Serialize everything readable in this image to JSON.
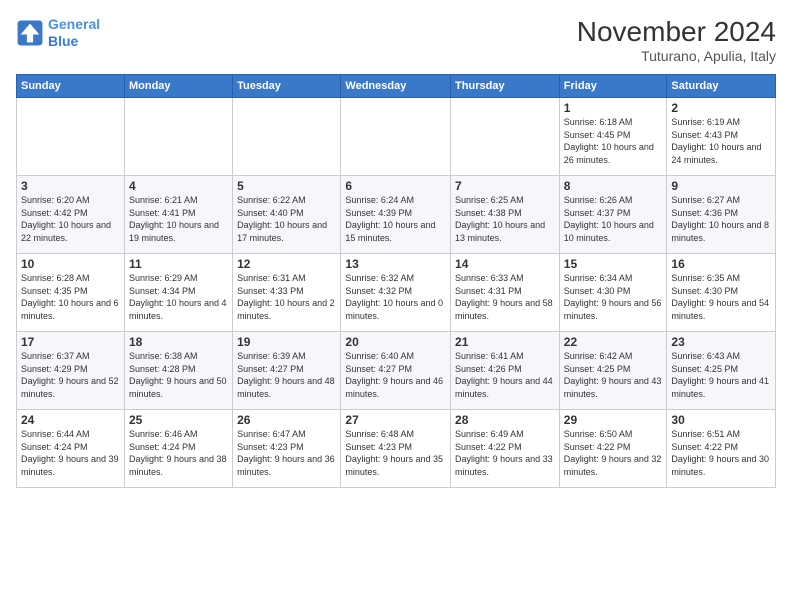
{
  "logo": {
    "line1": "General",
    "line2": "Blue"
  },
  "title": "November 2024",
  "subtitle": "Tuturano, Apulia, Italy",
  "weekdays": [
    "Sunday",
    "Monday",
    "Tuesday",
    "Wednesday",
    "Thursday",
    "Friday",
    "Saturday"
  ],
  "weeks": [
    [
      {
        "day": "",
        "info": ""
      },
      {
        "day": "",
        "info": ""
      },
      {
        "day": "",
        "info": ""
      },
      {
        "day": "",
        "info": ""
      },
      {
        "day": "",
        "info": ""
      },
      {
        "day": "1",
        "info": "Sunrise: 6:18 AM\nSunset: 4:45 PM\nDaylight: 10 hours and 26 minutes."
      },
      {
        "day": "2",
        "info": "Sunrise: 6:19 AM\nSunset: 4:43 PM\nDaylight: 10 hours and 24 minutes."
      }
    ],
    [
      {
        "day": "3",
        "info": "Sunrise: 6:20 AM\nSunset: 4:42 PM\nDaylight: 10 hours and 22 minutes."
      },
      {
        "day": "4",
        "info": "Sunrise: 6:21 AM\nSunset: 4:41 PM\nDaylight: 10 hours and 19 minutes."
      },
      {
        "day": "5",
        "info": "Sunrise: 6:22 AM\nSunset: 4:40 PM\nDaylight: 10 hours and 17 minutes."
      },
      {
        "day": "6",
        "info": "Sunrise: 6:24 AM\nSunset: 4:39 PM\nDaylight: 10 hours and 15 minutes."
      },
      {
        "day": "7",
        "info": "Sunrise: 6:25 AM\nSunset: 4:38 PM\nDaylight: 10 hours and 13 minutes."
      },
      {
        "day": "8",
        "info": "Sunrise: 6:26 AM\nSunset: 4:37 PM\nDaylight: 10 hours and 10 minutes."
      },
      {
        "day": "9",
        "info": "Sunrise: 6:27 AM\nSunset: 4:36 PM\nDaylight: 10 hours and 8 minutes."
      }
    ],
    [
      {
        "day": "10",
        "info": "Sunrise: 6:28 AM\nSunset: 4:35 PM\nDaylight: 10 hours and 6 minutes."
      },
      {
        "day": "11",
        "info": "Sunrise: 6:29 AM\nSunset: 4:34 PM\nDaylight: 10 hours and 4 minutes."
      },
      {
        "day": "12",
        "info": "Sunrise: 6:31 AM\nSunset: 4:33 PM\nDaylight: 10 hours and 2 minutes."
      },
      {
        "day": "13",
        "info": "Sunrise: 6:32 AM\nSunset: 4:32 PM\nDaylight: 10 hours and 0 minutes."
      },
      {
        "day": "14",
        "info": "Sunrise: 6:33 AM\nSunset: 4:31 PM\nDaylight: 9 hours and 58 minutes."
      },
      {
        "day": "15",
        "info": "Sunrise: 6:34 AM\nSunset: 4:30 PM\nDaylight: 9 hours and 56 minutes."
      },
      {
        "day": "16",
        "info": "Sunrise: 6:35 AM\nSunset: 4:30 PM\nDaylight: 9 hours and 54 minutes."
      }
    ],
    [
      {
        "day": "17",
        "info": "Sunrise: 6:37 AM\nSunset: 4:29 PM\nDaylight: 9 hours and 52 minutes."
      },
      {
        "day": "18",
        "info": "Sunrise: 6:38 AM\nSunset: 4:28 PM\nDaylight: 9 hours and 50 minutes."
      },
      {
        "day": "19",
        "info": "Sunrise: 6:39 AM\nSunset: 4:27 PM\nDaylight: 9 hours and 48 minutes."
      },
      {
        "day": "20",
        "info": "Sunrise: 6:40 AM\nSunset: 4:27 PM\nDaylight: 9 hours and 46 minutes."
      },
      {
        "day": "21",
        "info": "Sunrise: 6:41 AM\nSunset: 4:26 PM\nDaylight: 9 hours and 44 minutes."
      },
      {
        "day": "22",
        "info": "Sunrise: 6:42 AM\nSunset: 4:25 PM\nDaylight: 9 hours and 43 minutes."
      },
      {
        "day": "23",
        "info": "Sunrise: 6:43 AM\nSunset: 4:25 PM\nDaylight: 9 hours and 41 minutes."
      }
    ],
    [
      {
        "day": "24",
        "info": "Sunrise: 6:44 AM\nSunset: 4:24 PM\nDaylight: 9 hours and 39 minutes."
      },
      {
        "day": "25",
        "info": "Sunrise: 6:46 AM\nSunset: 4:24 PM\nDaylight: 9 hours and 38 minutes."
      },
      {
        "day": "26",
        "info": "Sunrise: 6:47 AM\nSunset: 4:23 PM\nDaylight: 9 hours and 36 minutes."
      },
      {
        "day": "27",
        "info": "Sunrise: 6:48 AM\nSunset: 4:23 PM\nDaylight: 9 hours and 35 minutes."
      },
      {
        "day": "28",
        "info": "Sunrise: 6:49 AM\nSunset: 4:22 PM\nDaylight: 9 hours and 33 minutes."
      },
      {
        "day": "29",
        "info": "Sunrise: 6:50 AM\nSunset: 4:22 PM\nDaylight: 9 hours and 32 minutes."
      },
      {
        "day": "30",
        "info": "Sunrise: 6:51 AM\nSunset: 4:22 PM\nDaylight: 9 hours and 30 minutes."
      }
    ]
  ]
}
